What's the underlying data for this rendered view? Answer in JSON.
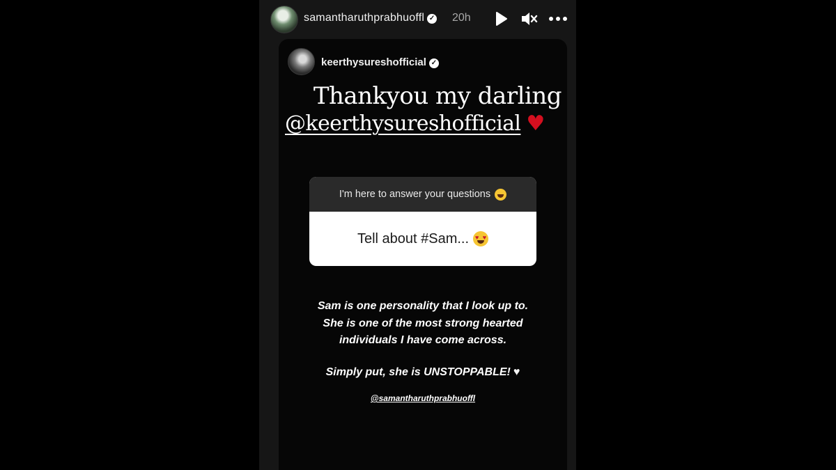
{
  "story": {
    "username": "samantharuthprabhuoffl",
    "time_ago": "20h",
    "verified_mark": "✓",
    "icons": [
      "play-icon",
      "mute-icon",
      "more-icon"
    ]
  },
  "shared_post": {
    "username": "keerthysureshofficial",
    "verified_mark": "✓",
    "headline_line1": "Thankyou my darling",
    "headline_mention": "@keerthysureshofficial",
    "heart": "♥",
    "question_box": {
      "header": "I'm here to answer your questions",
      "question": "Tell about #Sam..."
    },
    "answer_lines": [
      "Sam is one personality that I look up to.",
      "She is one of the most strong hearted",
      "individuals I have come across."
    ],
    "closing": "Simply put, she is UNSTOPPABLE!",
    "closing_heart": "♥",
    "footer_mention": "@samantharuthprabhuoffl"
  },
  "colors": {
    "page_bg": "#000000",
    "story_bg": "#161616",
    "card_bg": "#060606",
    "heart_red": "#d40f1f",
    "question_header_bg": "#2a2a2a"
  }
}
